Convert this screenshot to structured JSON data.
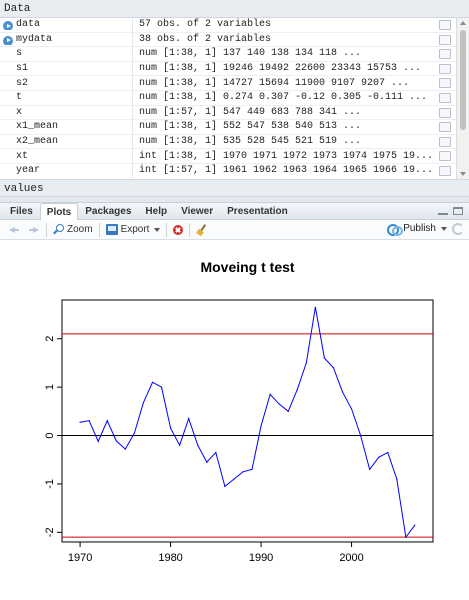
{
  "environment": {
    "data_header": "Data",
    "values_header": "values",
    "rows": [
      {
        "name": "data",
        "value": "57 obs. of 2 variables",
        "expandable": true
      },
      {
        "name": "mydata",
        "value": "38 obs. of 2 variables",
        "expandable": true
      },
      {
        "name": "s",
        "value": "num [1:38, 1] 137 140 138 134 118 ..."
      },
      {
        "name": "s1",
        "value": "num [1:38, 1] 19246 19492 22600 23343 15753 ..."
      },
      {
        "name": "s2",
        "value": "num [1:38, 1] 14727 15694 11900 9107 9207 ..."
      },
      {
        "name": "t",
        "value": "num [1:38, 1] 0.274 0.307 -0.12 0.305 -0.111 ..."
      },
      {
        "name": "x",
        "value": "num [1:57, 1] 547 449 683 788 341 ..."
      },
      {
        "name": "x1_mean",
        "value": "num [1:38, 1] 552 547 538 540 513 ..."
      },
      {
        "name": "x2_mean",
        "value": "num [1:38, 1] 535 528 545 521 519 ..."
      },
      {
        "name": "xt",
        "value": "int [1:38, 1] 1970 1971 1972 1973 1974 1975 19..."
      },
      {
        "name": "year",
        "value": "int [1:57, 1] 1961 1962 1963 1964 1965 1966 19..."
      }
    ]
  },
  "pane": {
    "tabs": [
      "Files",
      "Plots",
      "Packages",
      "Help",
      "Viewer",
      "Presentation"
    ],
    "active_tab": "Plots",
    "toolbar": {
      "zoom": "Zoom",
      "export": "Export",
      "publish": "Publish"
    }
  },
  "chart_data": {
    "type": "line",
    "title": "Moveing t test",
    "xlabel": "",
    "ylabel": "",
    "xlim": [
      1968,
      2009
    ],
    "ylim": [
      -2.2,
      2.8
    ],
    "xticks": [
      "1970",
      "1980",
      "1990",
      "2000"
    ],
    "yticks": [
      "-2",
      "-1",
      "0",
      "1",
      "2"
    ],
    "colors": {
      "series": "#0000ff",
      "threshold": "#cc0000",
      "zero": "#000000"
    },
    "reference_lines": [
      2.1,
      -2.1,
      0
    ],
    "series": [
      {
        "x": [
          1970,
          1971,
          1972,
          1973,
          1974,
          1975,
          1976,
          1977,
          1978,
          1979,
          1980,
          1981,
          1982,
          1983,
          1984,
          1985,
          1986,
          1987,
          1988,
          1989,
          1990,
          1991,
          1992,
          1993,
          1994,
          1995,
          1996,
          1997,
          1998,
          1999,
          2000,
          2001,
          2002,
          2003,
          2004,
          2005,
          2006,
          2007
        ],
        "y": [
          0.274,
          0.307,
          -0.12,
          0.305,
          -0.111,
          -0.28,
          0.05,
          0.68,
          1.1,
          1.0,
          0.15,
          -0.2,
          0.35,
          -0.2,
          -0.55,
          -0.35,
          -1.05,
          -0.9,
          -0.75,
          -0.7,
          0.2,
          0.85,
          0.65,
          0.5,
          0.95,
          1.5,
          2.65,
          1.6,
          1.4,
          0.9,
          0.55,
          0.0,
          -0.7,
          -0.45,
          -0.35,
          -0.9,
          -2.1,
          -1.85
        ]
      }
    ]
  }
}
